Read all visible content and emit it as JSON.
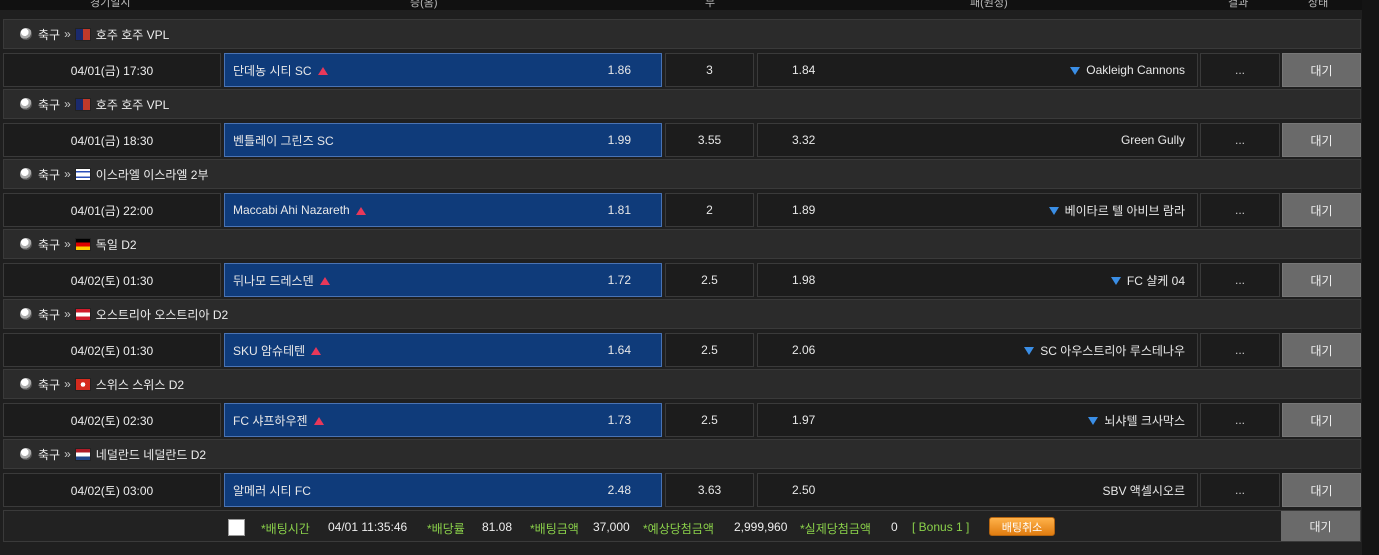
{
  "header": {
    "col_time": "경기일시",
    "col_home": "승(홈)",
    "col_draw": "무",
    "col_away": "패(원정)",
    "col_result": "결과",
    "col_status": "상태"
  },
  "matches": [
    {
      "sport": "축구",
      "league": "호주 호주 VPL",
      "flag": "au",
      "time": "04/01(금) 17:30",
      "home": "단데농 시티 SC",
      "home_odds": "1.86",
      "draw": "3",
      "away_odds": "1.84",
      "away": "Oakleigh Cannons",
      "home_up": true,
      "away_down": true,
      "result": "...",
      "status": "대기"
    },
    {
      "sport": "축구",
      "league": "호주 호주 VPL",
      "flag": "au",
      "time": "04/01(금) 18:30",
      "home": "벤틀레이 그린즈 SC",
      "home_odds": "1.99",
      "draw": "3.55",
      "away_odds": "3.32",
      "away": "Green Gully",
      "home_up": false,
      "away_down": false,
      "result": "...",
      "status": "대기"
    },
    {
      "sport": "축구",
      "league": "이스라엘 이스라엘 2부",
      "flag": "il",
      "time": "04/01(금) 22:00",
      "home": "Maccabi Ahi Nazareth",
      "home_odds": "1.81",
      "draw": "2",
      "away_odds": "1.89",
      "away": "베이타르 텔 아비브 람라",
      "home_up": true,
      "away_down": true,
      "result": "...",
      "status": "대기"
    },
    {
      "sport": "축구",
      "league": "독일 D2",
      "flag": "de",
      "time": "04/02(토) 01:30",
      "home": "뒤나모 드레스덴",
      "home_odds": "1.72",
      "draw": "2.5",
      "away_odds": "1.98",
      "away": "FC 샬케 04",
      "home_up": true,
      "away_down": true,
      "result": "...",
      "status": "대기"
    },
    {
      "sport": "축구",
      "league": "오스트리아 오스트리아 D2",
      "flag": "at",
      "time": "04/02(토) 01:30",
      "home": "SKU 암슈테텐",
      "home_odds": "1.64",
      "draw": "2.5",
      "away_odds": "2.06",
      "away": "SC 아우스트리아 루스테나우",
      "home_up": true,
      "away_down": true,
      "result": "...",
      "status": "대기"
    },
    {
      "sport": "축구",
      "league": "스위스 스위스 D2",
      "flag": "ch",
      "time": "04/02(토) 02:30",
      "home": "FC 샤프하우젠",
      "home_odds": "1.73",
      "draw": "2.5",
      "away_odds": "1.97",
      "away": "뇌샤텔 크사막스",
      "home_up": true,
      "away_down": true,
      "result": "...",
      "status": "대기"
    },
    {
      "sport": "축구",
      "league": "네덜란드 네덜란드 D2",
      "flag": "nl",
      "time": "04/02(토) 03:00",
      "home": "알메러 시티 FC",
      "home_odds": "2.48",
      "draw": "3.63",
      "away_odds": "2.50",
      "away": "SBV 액셀시오르",
      "home_up": false,
      "away_down": false,
      "result": "...",
      "status": "대기"
    }
  ],
  "footer": {
    "bet_time_label": "*배팅시간",
    "bet_time": "04/01 11:35:46",
    "odds_label": "*배당률",
    "odds": "81.08",
    "amount_label": "*배팅금액",
    "amount": "37,000",
    "expected_label": "*예상당첨금액",
    "expected": "2,999,960",
    "actual_label": "*실제당첨금액",
    "actual": "0",
    "bonus": "[ Bonus 1 ]",
    "cancel_label": "배팅취소",
    "status": "대기"
  },
  "colors": {
    "home_bg": "#0f3b7a",
    "up_arrow": "#e8385a",
    "down_arrow": "#3a8ee6",
    "label_green": "#8ad04a",
    "cancel_orange": "#f0941e",
    "status_gray": "#6a6a6a"
  }
}
